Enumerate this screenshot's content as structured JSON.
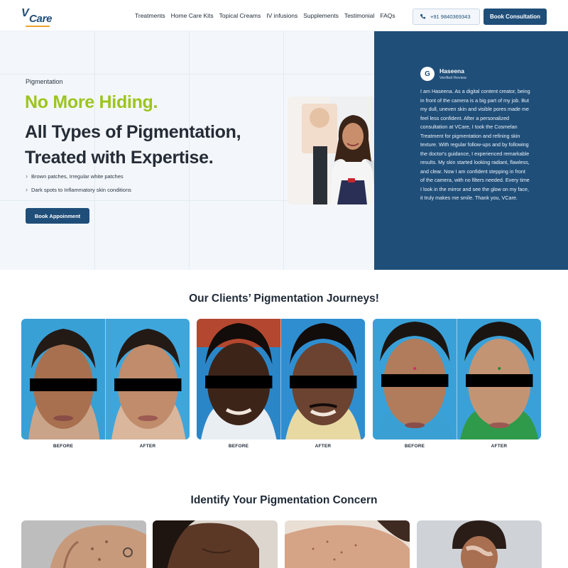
{
  "brand": {
    "logo_text": "Care",
    "logo_v": "V"
  },
  "nav": {
    "items": [
      "Treatments",
      "Home Care Kits",
      "Topical Creams",
      "IV infusions",
      "Supplements",
      "Testimonial",
      "FAQs"
    ],
    "phone": "+91 9840369343",
    "cta": "Book Consultation"
  },
  "hero": {
    "eyebrow": "Pigmentation",
    "headline_accent": "No More Hiding.",
    "headline_main": "All Types of Pigmentation, Treated with Expertise.",
    "bullets": [
      "Brown patches, Irregular white patches",
      "Dark spots to Inflammatory skin conditions"
    ],
    "button": "Book Appoinment"
  },
  "testimonial": {
    "initial": "G",
    "name": "Haseena",
    "verified": "Verified Review",
    "body": "I am Haseena. As a digital content creator, being in front of the camera is a big part of my job. But my dull, uneven skin and visible pores made me feel less confident. After a personalized consultation at VCare, I took the Cosmelan Treatment for pigmentation and refining skin texture. With regular follow-ups and by following the doctor's guidance, I experienced remarkable results. My skin started looking radiant, flawless, and clear. Now I am confident stepping in front of the camera, with no filters needed. Every time I look in the mirror and see the glow on my face, it truly makes me smile. Thank you, VCare."
  },
  "journeys": {
    "title": "Our Clients’ Pigmentation Journeys!",
    "labels": [
      "BEFORE",
      "AFTER",
      "BEFORE",
      "AFTER",
      "BEFORE",
      "AFTER"
    ]
  },
  "concerns": {
    "title": "Identify Your Pigmentation Concern"
  },
  "colors": {
    "primary": "#1f4e79",
    "accent_green": "#9dc41f",
    "hero_bg": "#f3f7fb"
  }
}
